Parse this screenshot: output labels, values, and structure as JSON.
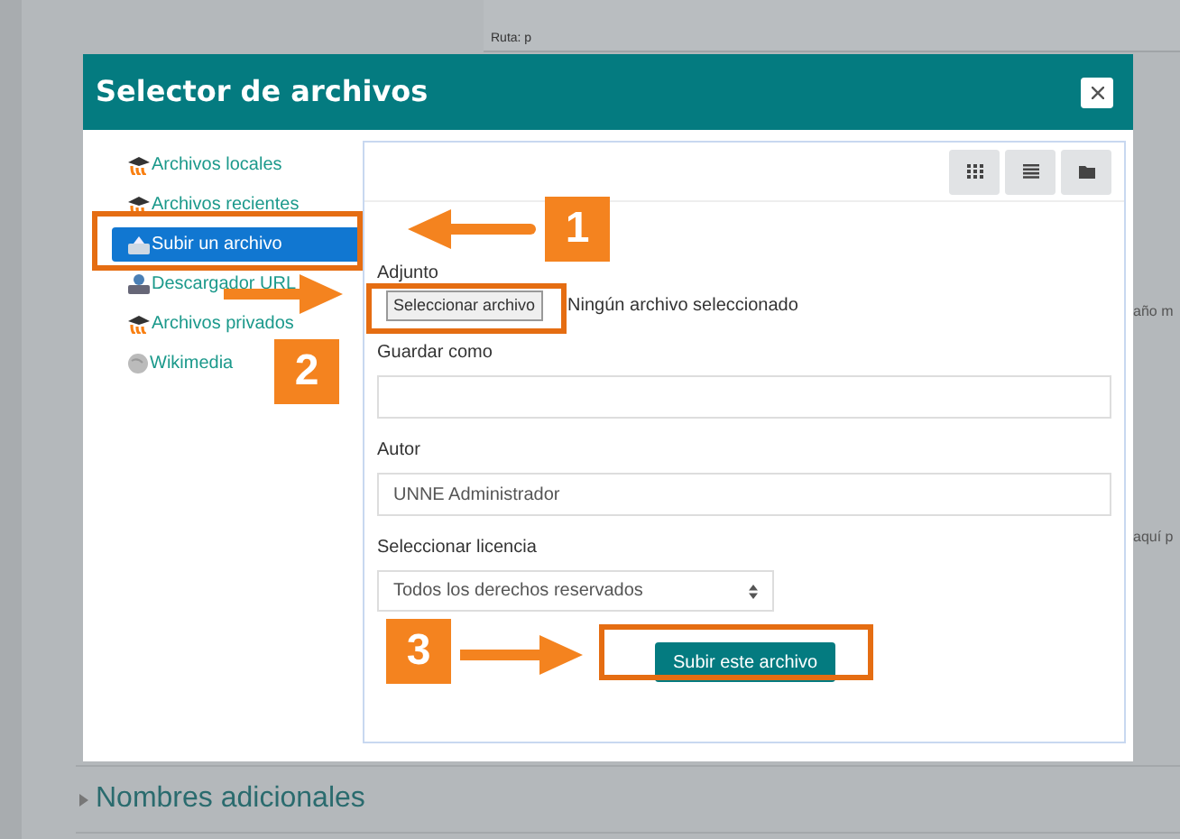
{
  "background": {
    "path_label": "Ruta: p",
    "side_text_1": "año m",
    "side_text_2": "aquí p",
    "section_title": "Nombres adicionales"
  },
  "dialog": {
    "title": "Selector de archivos"
  },
  "sidebar": {
    "items": [
      {
        "label": "Archivos locales",
        "kind": "moodle",
        "selected": false
      },
      {
        "label": "Archivos recientes",
        "kind": "moodle",
        "selected": false
      },
      {
        "label": "Subir un archivo",
        "kind": "upload",
        "selected": true
      },
      {
        "label": "Descargador URL",
        "kind": "download",
        "selected": false
      },
      {
        "label": "Archivos privados",
        "kind": "moodle",
        "selected": false
      },
      {
        "label": "Wikimedia",
        "kind": "globe",
        "selected": false
      }
    ]
  },
  "form": {
    "attachment_label": "Adjunto",
    "file_button": "Seleccionar archivo",
    "file_status": "Ningún archivo seleccionado",
    "save_as_label": "Guardar como",
    "author_label": "Autor",
    "author_value": "UNNE Administrador",
    "license_label": "Seleccionar licencia",
    "license_value": "Todos los derechos reservados",
    "submit": "Subir este archivo"
  },
  "annotations": [
    "1",
    "2",
    "3"
  ]
}
